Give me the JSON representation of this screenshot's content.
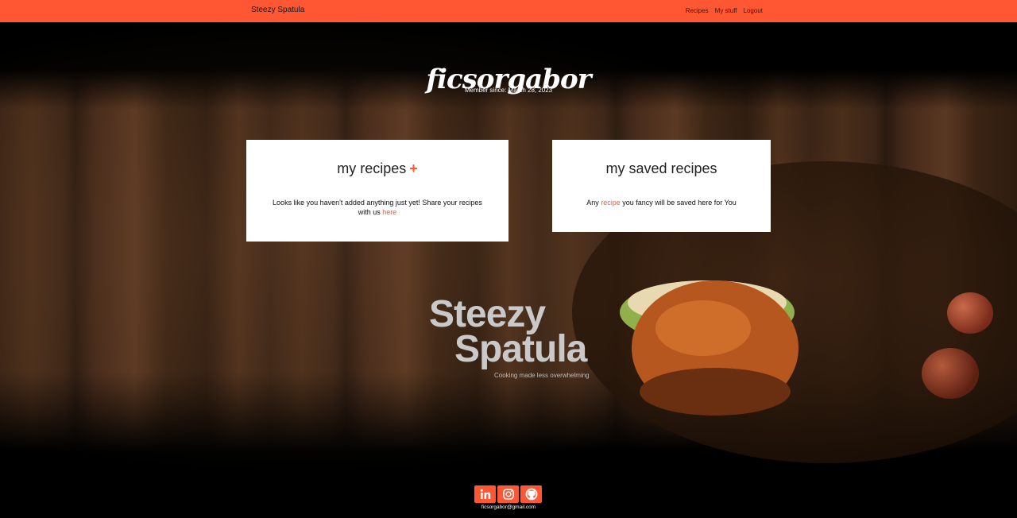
{
  "navbar": {
    "brand": "Steezy Spatula",
    "links": [
      "Recipes",
      "My stuff",
      "Logout"
    ]
  },
  "profile": {
    "username": "ficsorgabor",
    "member_since": "Member since: March 28, 2023"
  },
  "my_recipes": {
    "title": "my recipes",
    "add_symbol": "+",
    "empty_text": "Looks like you haven't added anything just yet! Share your recipes with us ",
    "link_text": "here"
  },
  "saved_recipes": {
    "title": "my saved recipes",
    "text_before": "Any ",
    "link_text": "recipe",
    "text_after": " you fancy will be saved here for You"
  },
  "logo": {
    "line1": "Steezy",
    "line2": "Spatula",
    "tagline": "Cooking made less overwhelming"
  },
  "footer": {
    "socials": [
      "linkedin-icon",
      "instagram-icon",
      "github-icon"
    ],
    "email": "ficsorgabor@gmail.com"
  },
  "colors": {
    "accent": "#ff5733"
  }
}
